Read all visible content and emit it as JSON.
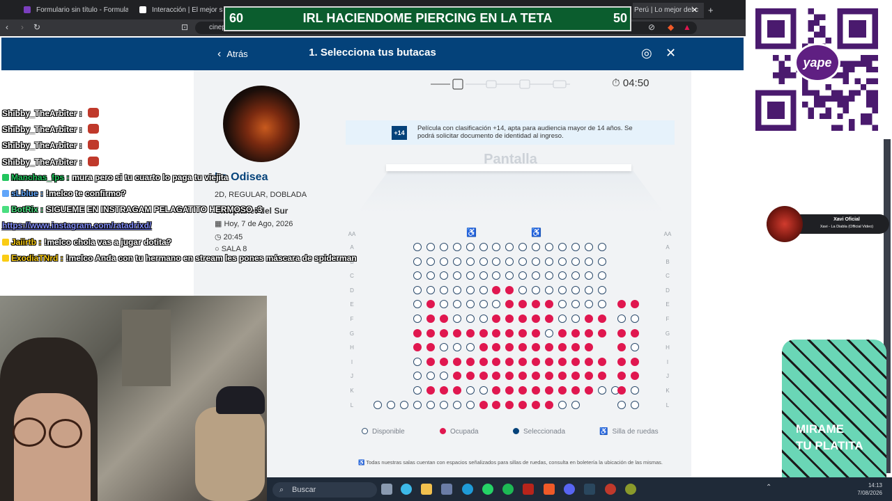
{
  "browser": {
    "tabs": [
      {
        "label": "Formulario sin título - Formularios de"
      },
      {
        "label": "Interacción | El mejor software"
      },
      {
        "label": "Perú | Lo mejor del c"
      }
    ],
    "url": "cineplanet.com.pe/compra/la-odisea/.../butacas"
  },
  "banner": {
    "left_number": "60",
    "title": "IRL HACIENDOME PIERCING EN LA TETA",
    "right_number": "50"
  },
  "header": {
    "back_label": "Atrás",
    "title": "1. Selecciona tus butacas"
  },
  "movie": {
    "title": "La Odisea",
    "format": "2D, REGULAR, DOBLADA",
    "cinema": "Cineplanet del Sur",
    "date": "Hoy, 7 de Ago, 2026",
    "time": "20:45",
    "room": "SALA 8"
  },
  "timer": "04:50",
  "rating": {
    "badge": "+14",
    "text": "Película con clasificación +14, apta para audiencia mayor de 14 años. Se podrá solicitar documento de identidad al ingreso."
  },
  "screen_label": "Pantalla",
  "aisle_label": "AA",
  "rows": [
    {
      "label": "A",
      "left": "",
      "main": "ddddddddddddddd",
      "right": ""
    },
    {
      "label": "B",
      "left": "",
      "main": "ddddddddddddddd",
      "right": ""
    },
    {
      "label": "C",
      "left": "",
      "main": "ddddddddddddddd",
      "right": ""
    },
    {
      "label": "D",
      "left": "",
      "main": "ddddddooddddddd",
      "right": ""
    },
    {
      "label": "E",
      "left": "",
      "main": "dodddddoooodddd",
      "right": "oo"
    },
    {
      "label": "F",
      "left": "",
      "main": "doodddoooooddoo",
      "right": "dd"
    },
    {
      "label": "G",
      "left": "",
      "main": "oooooooooodoooo",
      "right": "oo"
    },
    {
      "label": "H",
      "left": "",
      "main": "oodddooooooooo",
      "right": "od"
    },
    {
      "label": "I",
      "left": "",
      "main": "doooooooooooooo",
      "right": "oo"
    },
    {
      "label": "J",
      "left": "",
      "main": "dddoooooooooooo",
      "right": "oo"
    },
    {
      "label": "K",
      "left": "",
      "main": "doooddoooooooodd",
      "right": "od"
    },
    {
      "label": "L",
      "left": "ddd",
      "main": "dddddoooooodd",
      "right": "dd"
    }
  ],
  "legend": {
    "available": "Disponible",
    "occupied": "Ocupada",
    "selected": "Seleccionada",
    "wheelchair": "Silla de ruedas"
  },
  "wheelchair_note": "Todas nuestras salas cuentan con espacios señalizados para sillas de ruedas, consulta en boletería la ubicación de las mismas.",
  "colors": {
    "brand": "#04427a",
    "occupied": "#e0174f",
    "available_border": "#2b4a6b"
  },
  "chat": [
    {
      "user": "Shibby_TheArbiter",
      "user_color": "#ffffff",
      "text": ""
    },
    {
      "user": "Shibby_TheArbiter",
      "user_color": "#ffffff",
      "text": ""
    },
    {
      "user": "Shibby_TheArbiter",
      "user_color": "#ffffff",
      "text": ""
    },
    {
      "user": "Shibby_TheArbiter",
      "user_color": "#ffffff",
      "text": ""
    },
    {
      "user": "Manchas_fps",
      "user_color": "#22c55e",
      "text": "mura pero si tu cuarto lo paga tu viejita"
    },
    {
      "user": "sLblue",
      "user_color": "#60a5fa",
      "text": "!melco te confirmo?"
    },
    {
      "user": "BotRix",
      "user_color": "#4ade80",
      "text": "SIGUEME EN INSTRAGAM PELAGATITO HERMOSO :3"
    },
    {
      "user": "",
      "user_color": "#818cf8",
      "text": "https://www.instagram.com/ratadrixd/"
    },
    {
      "user": "Jaiirtb",
      "user_color": "#facc15",
      "text": "!melco chola vas a jugar dotita?"
    },
    {
      "user": "ExodiaTNrd",
      "user_color": "#facc15",
      "text": "!melco Anda con tu hermano en stream les pones máscara de spiderman"
    }
  ],
  "now_playing": {
    "artist": "Xavi Oficial",
    "song": "Xavi - La Diabla (Official Video)"
  },
  "overlay_text": {
    "line1": "MIRAME",
    "line2": "TU PLATITA"
  },
  "taskbar": {
    "search_placeholder": "Buscar",
    "clock_time": "14:13",
    "clock_date": "7/08/2026"
  }
}
